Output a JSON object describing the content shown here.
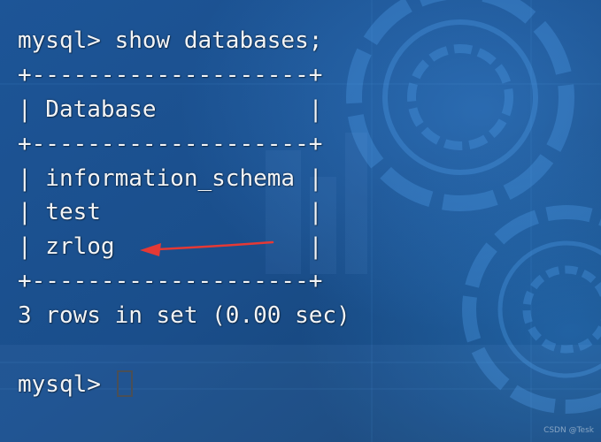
{
  "terminal": {
    "lines": [
      "mysql> show databases;",
      "+--------------------+",
      "| Database           |",
      "+--------------------+",
      "| information_schema |",
      "| test               |",
      "| zrlog              |",
      "+--------------------+",
      "3 rows in set (0.00 sec)",
      "",
      "mysql> "
    ]
  },
  "annotation": {
    "arrow_color": "#e53935",
    "points_to": "zrlog"
  },
  "watermark": {
    "text": "CSDN @Tesk"
  },
  "colors": {
    "background": "#1a4f8c",
    "text": "#f2f4f6",
    "cursor": "#4a4f56"
  }
}
